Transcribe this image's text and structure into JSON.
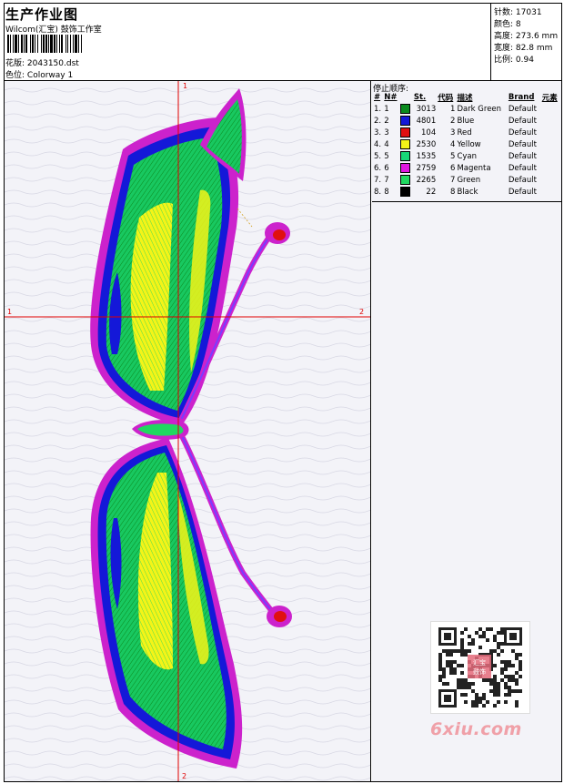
{
  "header": {
    "title": "生产作业图",
    "vendor": "Wilcom(汇宝) 鼓饰工作室",
    "design_label": "花版:",
    "design_value": "2043150.dst",
    "colorway_label": "色位:",
    "colorway_value": "Colorway 1"
  },
  "stats": [
    {
      "label": "针数:",
      "value": "17031"
    },
    {
      "label": "颜色:",
      "value": "8"
    },
    {
      "label": "高度:",
      "value": "273.6 mm"
    },
    {
      "label": "宽度:",
      "value": "82.8 mm"
    },
    {
      "label": "比例:",
      "value": "0.94"
    }
  ],
  "stop_sequence": {
    "title": "停止顺序:",
    "columns": [
      "#",
      "N#",
      "St.",
      "代码",
      "描述",
      "Brand",
      "元素"
    ],
    "rows": [
      {
        "idx": "1.",
        "n": "1",
        "color": "#0a8a1e",
        "st": "3013",
        "code": "1",
        "desc": "Dark Green",
        "brand": "Default"
      },
      {
        "idx": "2.",
        "n": "2",
        "color": "#1418d8",
        "st": "4801",
        "code": "2",
        "desc": "Blue",
        "brand": "Default"
      },
      {
        "idx": "3.",
        "n": "3",
        "color": "#e01010",
        "st": "104",
        "code": "3",
        "desc": "Red",
        "brand": "Default"
      },
      {
        "idx": "4.",
        "n": "4",
        "color": "#f4f418",
        "st": "2530",
        "code": "4",
        "desc": "Yellow",
        "brand": "Default"
      },
      {
        "idx": "5.",
        "n": "5",
        "color": "#18d878",
        "st": "1535",
        "code": "5",
        "desc": "Cyan",
        "brand": "Default"
      },
      {
        "idx": "6.",
        "n": "6",
        "color": "#e018e0",
        "st": "2759",
        "code": "6",
        "desc": "Magenta",
        "brand": "Default"
      },
      {
        "idx": "7.",
        "n": "7",
        "color": "#20d860",
        "st": "2265",
        "code": "7",
        "desc": "Green",
        "brand": "Default"
      },
      {
        "idx": "8.",
        "n": "8",
        "color": "#000000",
        "st": "22",
        "code": "8",
        "desc": "Black",
        "brand": "Default"
      }
    ]
  },
  "canvas": {
    "axis_labels": {
      "top": "1",
      "left": "1",
      "right": "2",
      "bottom": "2"
    },
    "crosshair_color": "#e00000"
  },
  "watermark": {
    "text": "6xiu.com",
    "seal_text": "汇宝鼓饰"
  }
}
